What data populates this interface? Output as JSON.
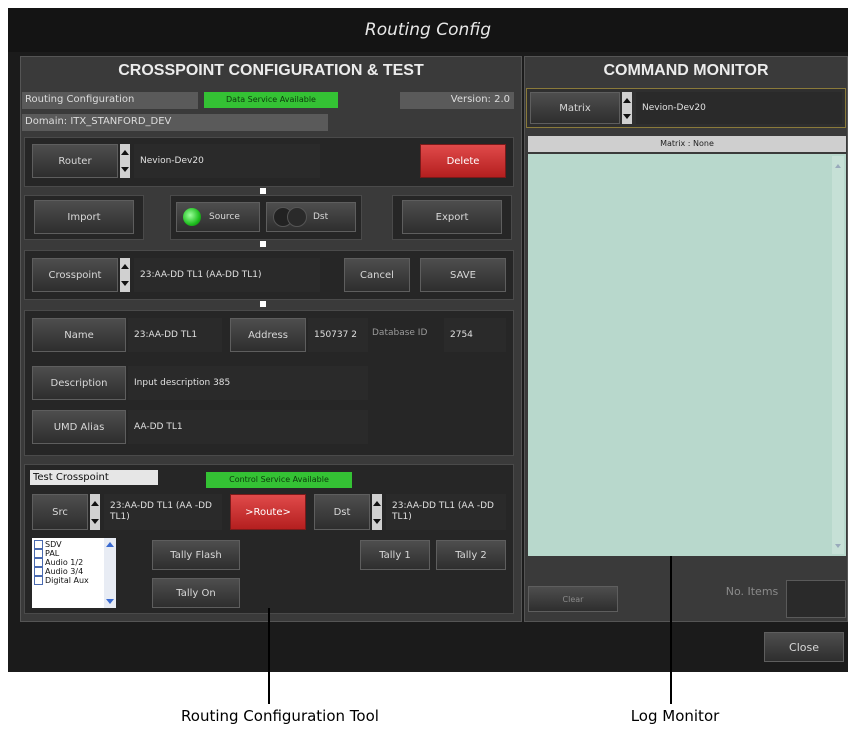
{
  "window": {
    "title": "Routing Config"
  },
  "crosspoint": {
    "header": "CROSSPOINT CONFIGURATION & TEST",
    "routing_config_label": "Routing Configuration",
    "data_service_status": "Data Service Available",
    "version": "Version: 2.0",
    "domain": "Domain: ITX_STANFORD_DEV",
    "router": {
      "label": "Router",
      "value": "Nevion-Dev20"
    },
    "delete_label": "Delete",
    "import_label": "Import",
    "source_label": "Source",
    "dst_label": "Dst",
    "export_label": "Export",
    "crosspoint_field": {
      "label": "Crosspoint",
      "value": "23:AA-DD TL1 (AA-DD TL1)"
    },
    "cancel_label": "Cancel",
    "save_label": "SAVE",
    "name": {
      "label": "Name",
      "value": "23:AA-DD TL1"
    },
    "address": {
      "label": "Address",
      "value": "150737 2"
    },
    "database_id": {
      "label": "Database ID",
      "value": "2754"
    },
    "description": {
      "label": "Description",
      "value": "Input description 385"
    },
    "umd_alias": {
      "label": "UMD Alias",
      "value": "AA-DD TL1"
    }
  },
  "test": {
    "title": "Test Crosspoint",
    "control_service_status": "Control Service Available",
    "src": {
      "label": "Src",
      "value": "23:AA-DD TL1 (AA -DD TL1)"
    },
    "route_label": ">Route>",
    "dst": {
      "label": "Dst",
      "value": "23:AA-DD TL1 (AA -DD TL1)"
    },
    "signal_list": [
      "SDV",
      "PAL",
      "Audio 1/2",
      "Audio 3/4",
      "Digital Aux"
    ],
    "tally_flash_label": "Tally Flash",
    "tally_on_label": "Tally On",
    "tally1_label": "Tally 1",
    "tally2_label": "Tally 2"
  },
  "monitor": {
    "header": "COMMAND MONITOR",
    "matrix": {
      "label": "Matrix",
      "value": "Nevion-Dev20"
    },
    "log_header": "Matrix : None",
    "clear_label": "Clear",
    "no_items_label": "No. Items",
    "no_items_value": ""
  },
  "close_label": "Close",
  "callouts": {
    "left": "Routing Configuration Tool",
    "right": "Log Monitor"
  },
  "colors": {
    "accent_green": "#34c234",
    "accent_red": "#d63232",
    "log_bg": "#b8d8cc"
  }
}
